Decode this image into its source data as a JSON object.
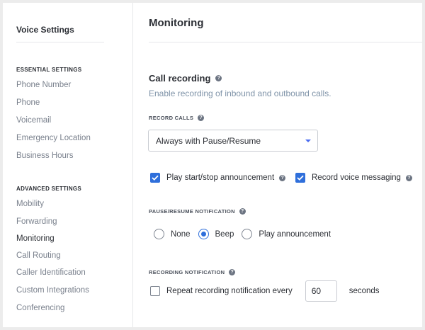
{
  "sidebar": {
    "title": "Voice Settings",
    "essential_heading": "ESSENTIAL SETTINGS",
    "essential_items": [
      "Phone Number",
      "Phone",
      "Voicemail",
      "Emergency Location",
      "Business Hours"
    ],
    "advanced_heading": "ADVANCED SETTINGS",
    "advanced_items": [
      "Mobility",
      "Forwarding",
      "Monitoring",
      "Call Routing",
      "Caller Identification",
      "Custom Integrations",
      "Conferencing"
    ],
    "active_item": "Monitoring"
  },
  "main": {
    "title": "Monitoring",
    "call_recording": {
      "title": "Call recording",
      "subtitle": "Enable recording of inbound and outbound calls."
    },
    "record_calls": {
      "label": "RECORD CALLS",
      "selected": "Always with Pause/Resume"
    },
    "checkboxes": {
      "play_announcement": {
        "label": "Play start/stop announcement",
        "checked": true
      },
      "record_voice_messaging": {
        "label": "Record voice messaging",
        "checked": true
      }
    },
    "pause_resume": {
      "label": "PAUSE/RESUME NOTIFICATION",
      "options": [
        "None",
        "Beep",
        "Play announcement"
      ],
      "selected": "Beep"
    },
    "recording_notification": {
      "label": "RECORDING NOTIFICATION",
      "repeat_label": "Repeat recording notification every",
      "repeat_checked": false,
      "interval_value": "60",
      "unit": "seconds"
    }
  },
  "colors": {
    "accent": "#2f6fdb",
    "text_dark": "#2c2f35",
    "text_muted": "#7a818d",
    "subtitle": "#7f93a8"
  },
  "icons": {
    "help": "question-circle-icon",
    "caret": "chevron-down-icon",
    "check": "checkmark-icon"
  }
}
